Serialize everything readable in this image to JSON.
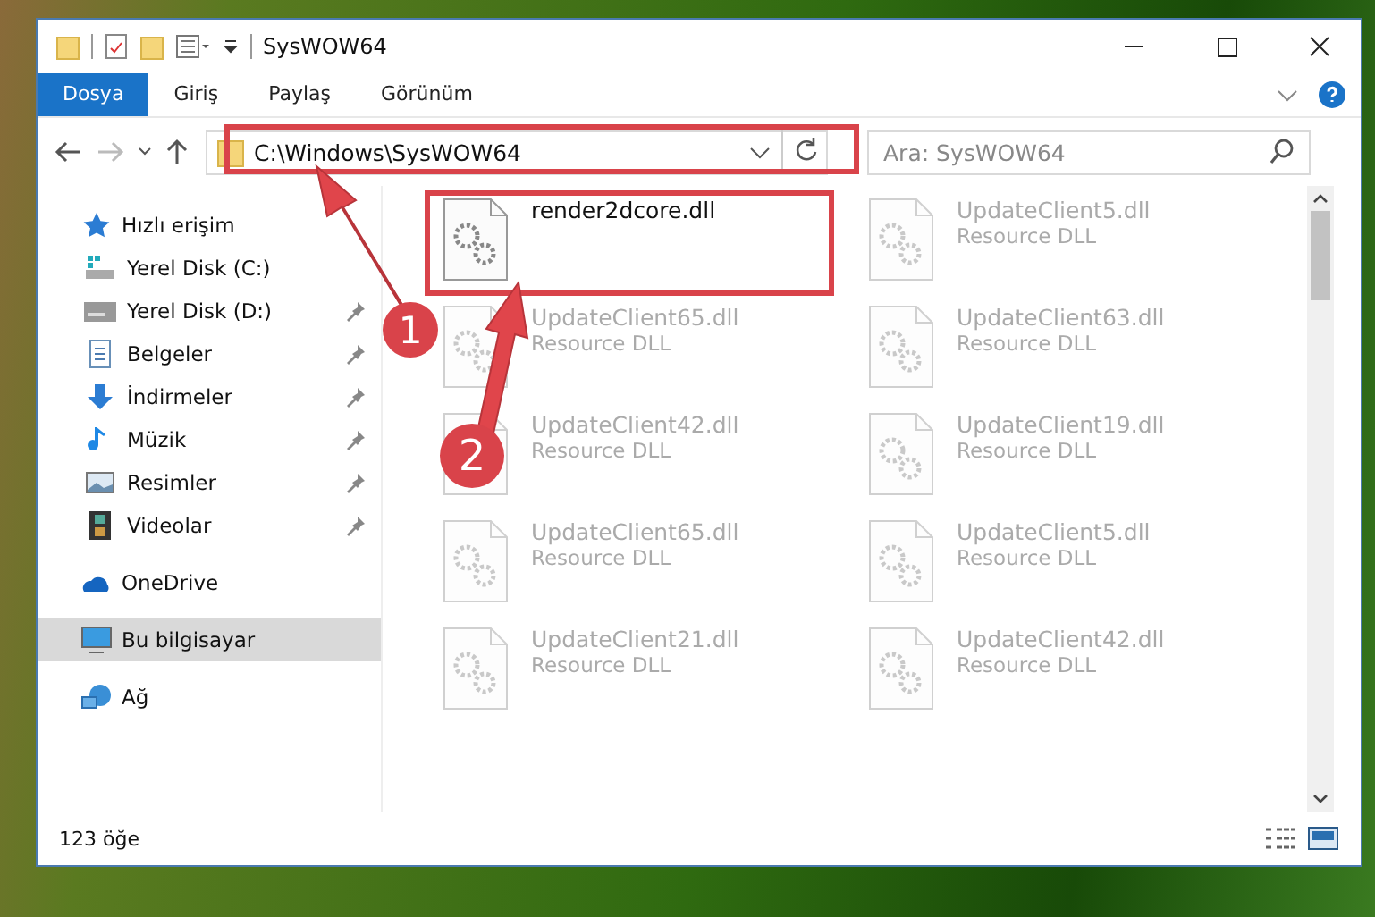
{
  "window": {
    "title": "SysWOW64"
  },
  "ribbon_tabs": [
    {
      "label": "Dosya",
      "selected": true
    },
    {
      "label": "Giriş",
      "selected": false
    },
    {
      "label": "Paylaş",
      "selected": false
    },
    {
      "label": "Görünüm",
      "selected": false
    }
  ],
  "address": {
    "path": "C:\\Windows\\SysWOW64"
  },
  "search": {
    "placeholder": "Ara: SysWOW64"
  },
  "sidebar": {
    "items": [
      {
        "label": "Hızlı erişim",
        "kind": "star",
        "selected": false,
        "children": [
          {
            "label": "Yerel Disk (C:)",
            "kind": "disk-c",
            "pinned": false
          },
          {
            "label": "Yerel Disk (D:)",
            "kind": "disk",
            "pinned": true
          },
          {
            "label": "Belgeler",
            "kind": "doc",
            "pinned": true
          },
          {
            "label": "İndirmeler",
            "kind": "download",
            "pinned": true
          },
          {
            "label": "Müzik",
            "kind": "music",
            "pinned": true
          },
          {
            "label": "Resimler",
            "kind": "picture",
            "pinned": true
          },
          {
            "label": "Videolar",
            "kind": "video",
            "pinned": true
          }
        ]
      },
      {
        "label": "OneDrive",
        "kind": "cloud",
        "selected": false
      },
      {
        "label": "Bu bilgisayar",
        "kind": "pc",
        "selected": true
      },
      {
        "label": "Ağ",
        "kind": "network",
        "selected": false
      }
    ]
  },
  "files": [
    {
      "name": "render2dcore.dll",
      "dimmed": false
    },
    {
      "name": "UpdateClient5.dll",
      "type": "Resource DLL",
      "dimmed": true
    },
    {
      "name": "UpdateClient65.dll",
      "type": "Resource DLL",
      "dimmed": true
    },
    {
      "name": "UpdateClient63.dll",
      "type": "Resource DLL",
      "dimmed": true
    },
    {
      "name": "UpdateClient42.dll",
      "type": "Resource DLL",
      "dimmed": true
    },
    {
      "name": "UpdateClient19.dll",
      "type": "Resource DLL",
      "dimmed": true
    },
    {
      "name": "UpdateClient65.dll",
      "type": "Resource DLL",
      "dimmed": true
    },
    {
      "name": "UpdateClient5.dll",
      "type": "Resource DLL",
      "dimmed": true
    },
    {
      "name": "UpdateClient21.dll",
      "type": "Resource DLL",
      "dimmed": true
    },
    {
      "name": "UpdateClient42.dll",
      "type": "Resource DLL",
      "dimmed": true
    }
  ],
  "status_bar": {
    "count": "123 öğe"
  },
  "annotations": [
    {
      "number": "1"
    },
    {
      "number": "2"
    }
  ]
}
